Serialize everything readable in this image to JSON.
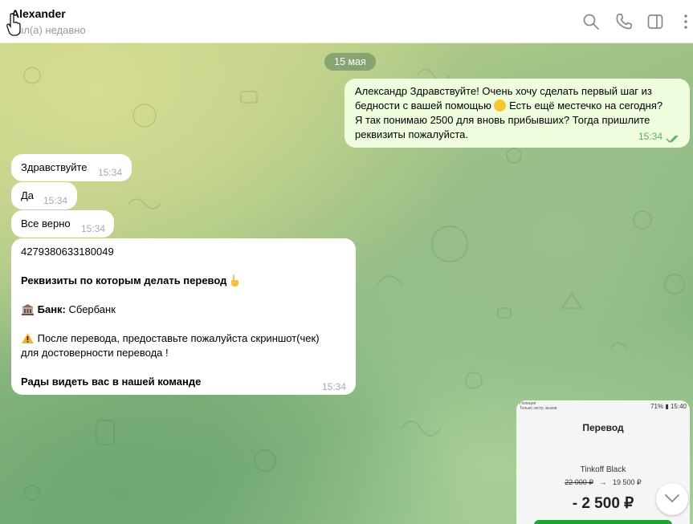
{
  "header": {
    "contact_name": "Alexander",
    "status": "ыл(а) недавно",
    "icons": [
      "search-icon",
      "phone-icon",
      "sidebar-toggle-icon",
      "more-vertical-icon"
    ]
  },
  "chat": {
    "date_label": "15 мая",
    "outgoing": {
      "lines": [
        "Александр Здравствуйте! Очень хочу сделать первый шаг из",
        "бедности с вашей помощью",
        " Есть ещё местечко на сегодня?",
        "Я так понимаю 2500 для вновь прибывших? Тогда пришлите",
        "реквизиты пожалуйста."
      ],
      "time": "15:34",
      "read_status": "double-check-icon"
    },
    "incoming": [
      {
        "text": "Здравствуйте",
        "time": "15:34"
      },
      {
        "text": "Да",
        "time": "15:34"
      },
      {
        "text": "Все верно",
        "time": "15:34"
      }
    ],
    "details_message": {
      "account_number": "4279380633180049",
      "requisites_title": "Реквизиты по которым делать перевод",
      "bank_label": "Банк:",
      "bank_name": " Сбербанк",
      "warning_line1": " После перевода, предоставьте пожалуйста скриншот(чек)",
      "warning_line2": "для достоверности перевода !",
      "closing": "Рады видеть вас в нашей команде",
      "time": "15:34"
    },
    "screenshot_image": {
      "status_left": "Полиция\nТолько экстр. вызов",
      "status_right": "71% ▮ 15:40",
      "title": "Перевод",
      "card_name": "Tinkoff Black",
      "balance_before": "22 000 ₽",
      "arrow": "→",
      "balance_after": "19 500 ₽",
      "amount": "- 2 500 ₽"
    }
  },
  "colors": {
    "incoming_bubble": "#ffffff",
    "outgoing_bubble": "#effdde",
    "outgoing_time": "#5dad5d",
    "incoming_time": "#a0acb6",
    "sber_green": "#21a038"
  }
}
